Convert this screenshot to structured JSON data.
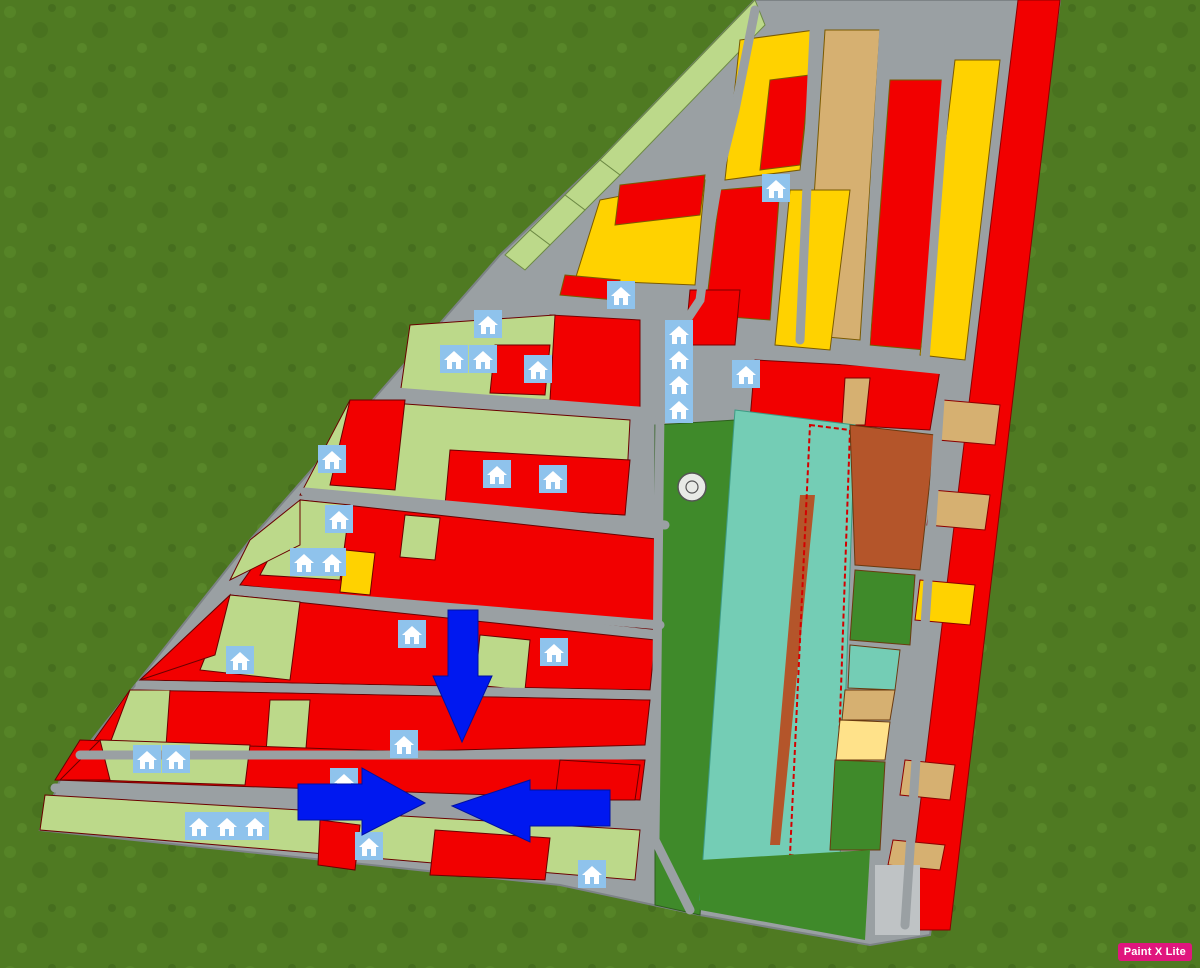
{
  "watermark": {
    "text": "Paint X Lite"
  },
  "legend_colors": {
    "grass": "#4f7a22",
    "road": "#9aa0a3",
    "sold_lot": "#f20000",
    "reserved_lot": "#ffd200",
    "available_lot": "#bcd98a",
    "tan_lot": "#d6b071",
    "pool": "#74cdb5",
    "brown_area": "#b4552a",
    "arrow": "#0018f0"
  },
  "icons": [
    "house-icon",
    "arrow-icon",
    "fountain-icon"
  ]
}
